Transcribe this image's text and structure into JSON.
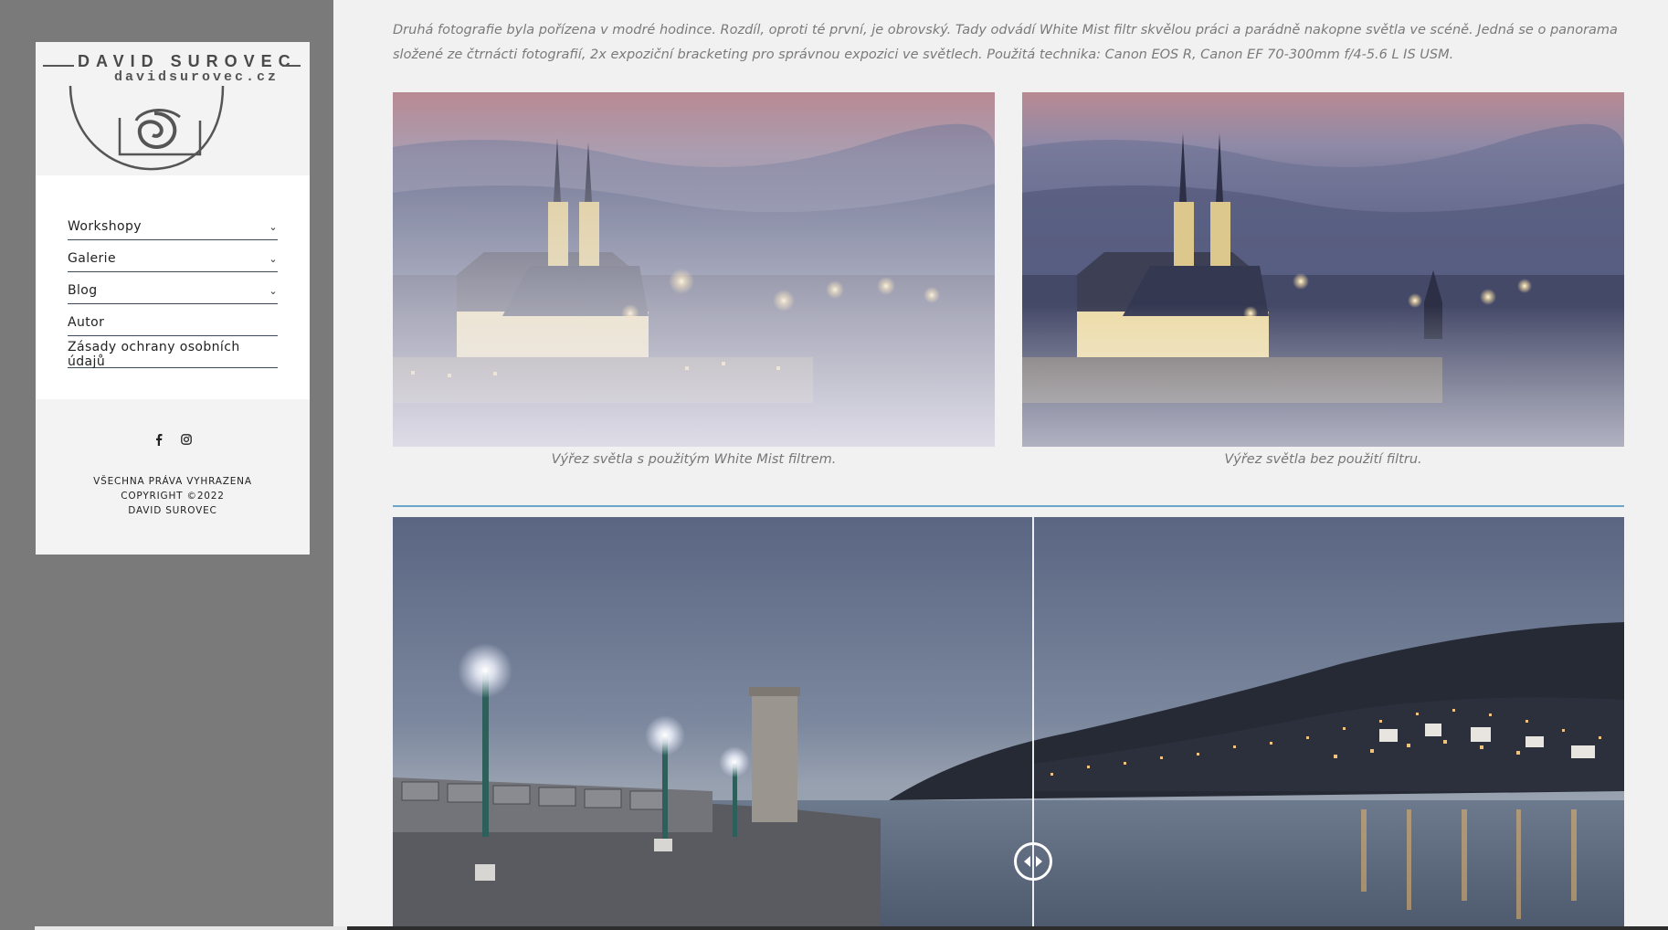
{
  "logo": {
    "name": "DAVID SUROVEC",
    "url": "davidsurovec.cz"
  },
  "menu": [
    {
      "label": "Workshopy",
      "has_submenu": true
    },
    {
      "label": "Galerie",
      "has_submenu": true
    },
    {
      "label": "Blog",
      "has_submenu": true
    },
    {
      "label": "Autor",
      "has_submenu": false
    },
    {
      "label": "Zásady ochrany osobních údajů",
      "has_submenu": false
    }
  ],
  "social": [
    "facebook-icon",
    "instagram-icon"
  ],
  "footer": {
    "line1": "VŠECHNA PRÁVA VYHRAZENA",
    "line2": "COPYRIGHT ©2022",
    "line3": "DAVID SUROVEC"
  },
  "article": {
    "intro": "Druhá fotografie byla pořízena v modré hodince. Rozdíl, oproti té první, je obrovský. Tady odvádí White Mist filtr skvělou práci a parádně nakopne světla ve scéně. Jedná se o panorama složené ze čtrnácti fotografií, 2x expoziční bracketing pro správnou expozici ve světlech. Použitá technika: Canon EOS R, Canon EF 70-300mm f/4-5.6 L IS USM.",
    "caption_left": "Výřez světla s použitým White Mist filtrem.",
    "caption_right": "Výřez světla bez použití filtru."
  },
  "compare_slider": {
    "position": 0.52
  },
  "colors": {
    "gutter": "#7a7a7a",
    "divider": "#6aa6c9",
    "text_muted": "#7a7a7a"
  }
}
